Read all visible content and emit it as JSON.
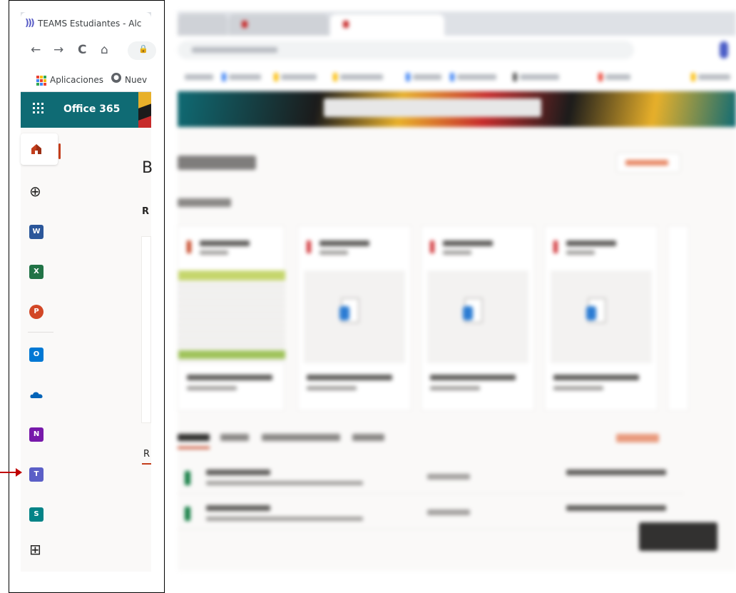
{
  "browser": {
    "tab_title": "TEAMS Estudiantes - Alc",
    "tab_favicon": ")))",
    "nav": {
      "back": "←",
      "forward": "→",
      "reload": "C",
      "home": "⌂",
      "lock": "🔒"
    },
    "bookmarks": {
      "apps_label": "Aplicaciones",
      "second_label": "Nuev"
    }
  },
  "suite_header": {
    "brand": "Office 365"
  },
  "app_rail": {
    "items": [
      {
        "key": "home",
        "icon": "home-icon",
        "color": "#c43e1c"
      },
      {
        "key": "create",
        "icon": "plus-circle-icon",
        "glyph": "⊕"
      },
      {
        "key": "word",
        "icon": "word-icon",
        "letter": "W",
        "color": "#2b579a"
      },
      {
        "key": "excel",
        "icon": "excel-icon",
        "letter": "X",
        "color": "#217346"
      },
      {
        "key": "powerpoint",
        "icon": "powerpoint-icon",
        "letter": "P",
        "color": "#d24726"
      },
      {
        "key": "outlook",
        "icon": "outlook-icon",
        "letter": "O",
        "color": "#0078d4"
      },
      {
        "key": "onedrive",
        "icon": "onedrive-icon",
        "color": "#0364b8"
      },
      {
        "key": "onenote",
        "icon": "onenote-icon",
        "letter": "N",
        "color": "#7719aa"
      },
      {
        "key": "teams",
        "icon": "teams-icon",
        "letter": "T",
        "color": "#5b5fc7"
      },
      {
        "key": "sharepoint",
        "icon": "sharepoint-icon",
        "letter": "S",
        "color": "#038387"
      },
      {
        "key": "all_apps",
        "icon": "all-apps-icon",
        "glyph": "⊞"
      }
    ]
  },
  "peek_letters": {
    "greeting": "B",
    "recent": "R",
    "tab": "R"
  },
  "colors": {
    "accent_red": "#c00000",
    "header_teal": "#0f6b74",
    "rail_bg": "#faf9f8"
  }
}
